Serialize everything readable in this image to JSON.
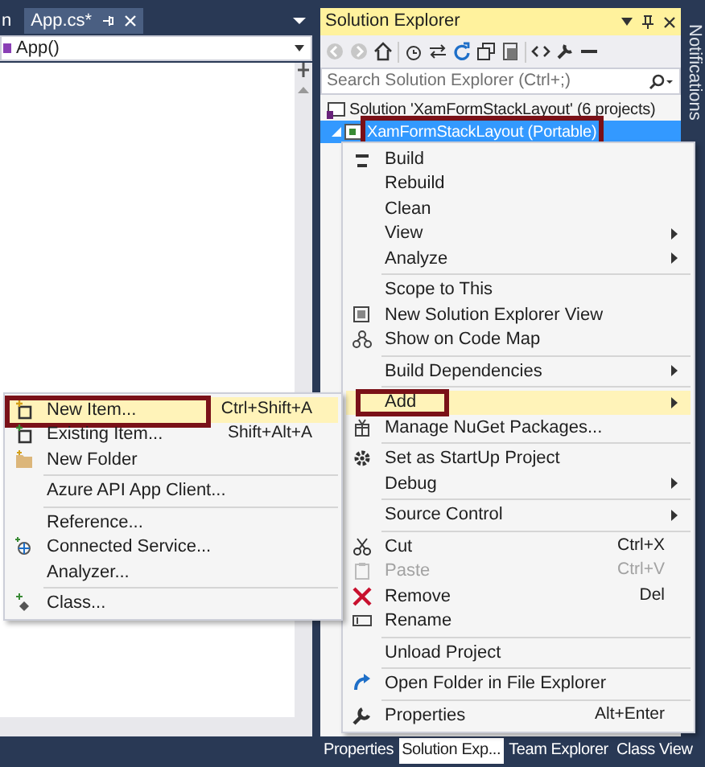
{
  "editor": {
    "tabs": [
      {
        "label": "n",
        "selected": false
      },
      {
        "label": "App.cs*",
        "selected": true
      }
    ],
    "member_dropdown": "App()"
  },
  "solution_explorer": {
    "title": "Solution Explorer",
    "search": {
      "placeholder": "Search Solution Explorer (Ctrl+;)"
    },
    "tree": [
      {
        "label": "Solution 'XamFormStackLayout' (6 projects)",
        "selected": false,
        "children": [
          {
            "label": "XamFormStackLayout (Portable)",
            "selected": true,
            "expanded": true,
            "annotated": true
          }
        ]
      }
    ]
  },
  "context_menu": {
    "items": [
      {
        "kind": "item",
        "label": "Build"
      },
      {
        "kind": "item",
        "label": "Rebuild"
      },
      {
        "kind": "item",
        "label": "Clean"
      },
      {
        "kind": "item",
        "label": "View",
        "submenu": true
      },
      {
        "kind": "item",
        "label": "Analyze",
        "submenu": true
      },
      {
        "kind": "separator"
      },
      {
        "kind": "item",
        "label": "Scope to This"
      },
      {
        "kind": "item",
        "label": "New Solution Explorer View"
      },
      {
        "kind": "item",
        "label": "Show on Code Map"
      },
      {
        "kind": "separator"
      },
      {
        "kind": "item",
        "label": "Build Dependencies",
        "submenu": true
      },
      {
        "kind": "separator"
      },
      {
        "kind": "item",
        "label": "Add",
        "submenu": true,
        "selected": true,
        "annotated": true
      },
      {
        "kind": "item",
        "label": "Manage NuGet Packages..."
      },
      {
        "kind": "separator"
      },
      {
        "kind": "item",
        "label": "Set as StartUp Project"
      },
      {
        "kind": "item",
        "label": "Debug",
        "submenu": true
      },
      {
        "kind": "separator"
      },
      {
        "kind": "item",
        "label": "Source Control",
        "submenu": true
      },
      {
        "kind": "separator"
      },
      {
        "kind": "item",
        "label": "Cut",
        "shortcut": "Ctrl+X"
      },
      {
        "kind": "item",
        "label": "Paste",
        "shortcut": "Ctrl+V",
        "disabled": true
      },
      {
        "kind": "item",
        "label": "Remove",
        "shortcut": "Del"
      },
      {
        "kind": "item",
        "label": "Rename"
      },
      {
        "kind": "separator"
      },
      {
        "kind": "item",
        "label": "Unload Project"
      },
      {
        "kind": "separator"
      },
      {
        "kind": "item",
        "label": "Open Folder in File Explorer"
      },
      {
        "kind": "separator"
      },
      {
        "kind": "item",
        "label": "Properties",
        "shortcut": "Alt+Enter"
      }
    ]
  },
  "add_submenu": {
    "items": [
      {
        "kind": "item",
        "label": "New Item...",
        "shortcut": "Ctrl+Shift+A",
        "selected": true,
        "annotated": true
      },
      {
        "kind": "item",
        "label": "Existing Item...",
        "shortcut": "Shift+Alt+A"
      },
      {
        "kind": "item",
        "label": "New Folder"
      },
      {
        "kind": "separator"
      },
      {
        "kind": "item",
        "label": "Azure API App Client..."
      },
      {
        "kind": "separator"
      },
      {
        "kind": "item",
        "label": "Reference..."
      },
      {
        "kind": "item",
        "label": "Connected Service..."
      },
      {
        "kind": "item",
        "label": "Analyzer..."
      },
      {
        "kind": "separator"
      },
      {
        "kind": "item",
        "label": "Class..."
      }
    ]
  },
  "bottom_tabs": [
    {
      "label": "Properties",
      "selected": false
    },
    {
      "label": "Solution Exp...",
      "selected": true
    },
    {
      "label": "Team Explorer",
      "selected": false
    },
    {
      "label": "Class View",
      "selected": false
    }
  ],
  "side_tab": "Notifications"
}
